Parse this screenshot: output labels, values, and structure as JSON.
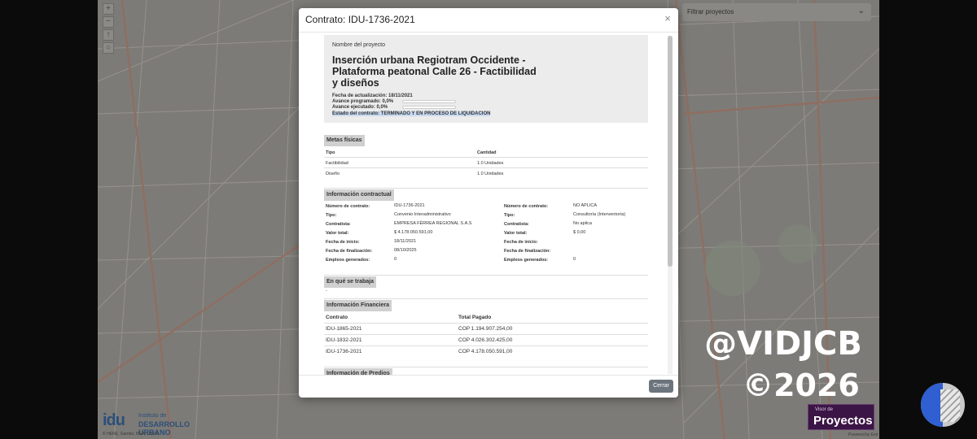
{
  "map": {
    "filter_placeholder": "Filtrar proyectos",
    "controls": [
      "+",
      "−",
      "↑",
      "○"
    ],
    "logo": {
      "mark": "idu",
      "line1": "Instituto de",
      "line2": "DESARROLLO URBANO"
    },
    "attribution": "© HERE, Garmin, NGA, USGS",
    "visor": {
      "line1": "Visor de",
      "line2": "Proyectos"
    },
    "powered": "Powered by Esri"
  },
  "watermark": {
    "handle": "@VIDJCB",
    "year": "©2026",
    "background_text": "vidjc"
  },
  "modal": {
    "title": "Contrato: IDU-1736-2021",
    "close_icon": "×",
    "close_button_label": "Cerrar",
    "summary": {
      "label": "Nombre del proyecto",
      "project_title": "Inserción urbana Regiotram Occidente - Plataforma peatonal Calle 26 - Factibilidad y diseños",
      "fecha_actualizacion": "Fecha de actualización: 18/11/2021",
      "avance_programado": "Avance programado: 0,0%",
      "avance_programado_value": 0,
      "avance_ejecutado": "Avance ejecutado: 0,0%",
      "avance_ejecutado_value": 0,
      "estado": "Estado del contrato: TERMINADO Y EN PROCESO DE LIQUIDACION"
    },
    "metas": {
      "title": "Metas físicas",
      "headers": [
        "Tipo",
        "Cantidad"
      ],
      "rows": [
        [
          "Factibilidad",
          "1.0 Unidades"
        ],
        [
          "Diseño",
          "1.0 Unidades"
        ]
      ]
    },
    "contractual": {
      "title": "Información contractual",
      "left": [
        [
          "Número de contrato:",
          "IDU-1736-2021"
        ],
        [
          "Tipo:",
          "Convenio Interadministrativo"
        ],
        [
          "Contratista:",
          "EMPRESA FÉRREA REGIONAL S.A.S"
        ],
        [
          "Valor total:",
          "$ 4.178.050.591,00"
        ],
        [
          "Fecha de inicio:",
          "18/11/2021"
        ],
        [
          "Fecha de finalización:",
          "08/10/2025"
        ],
        [
          "Empleos generados:",
          "0"
        ]
      ],
      "right": [
        [
          "Número de contrato:",
          "NO APLICA"
        ],
        [
          "Tipo:",
          "Consultoría (Interventoría)"
        ],
        [
          "Contratista:",
          "No aplica"
        ],
        [
          "Valor total:",
          "$ 0,00"
        ],
        [
          "Fecha de inicio:",
          ""
        ],
        [
          "Fecha de finalización:",
          ""
        ],
        [
          "Empleos generados:",
          "0"
        ]
      ]
    },
    "trabaja": {
      "title": "En qué se trabaja",
      "text": "-"
    },
    "financiera": {
      "title": "Información Financiera",
      "headers": [
        "Contrato",
        "Total Pagado"
      ],
      "rows": [
        [
          "IDU-1865-2021",
          "COP 1.194.907.254,00"
        ],
        [
          "IDU-1832-2021",
          "COP 4.026.302.425,00"
        ],
        [
          "IDU-1736-2021",
          "COP 4.178.050.591,00"
        ]
      ]
    },
    "predios": {
      "title": "Información de Predios"
    }
  }
}
